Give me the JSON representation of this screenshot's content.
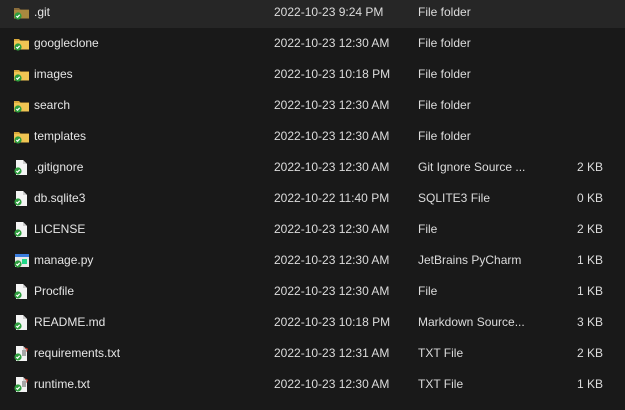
{
  "files": [
    {
      "name": ".git",
      "date": "2022-10-23 9:24 PM",
      "type": "File folder",
      "size": "",
      "icon": "folder-icon"
    },
    {
      "name": "googleclone",
      "date": "2022-10-23 12:30 AM",
      "type": "File folder",
      "size": "",
      "icon": "folder-icon"
    },
    {
      "name": "images",
      "date": "2022-10-23 10:18 PM",
      "type": "File folder",
      "size": "",
      "icon": "folder-icon"
    },
    {
      "name": "search",
      "date": "2022-10-23 12:30 AM",
      "type": "File folder",
      "size": "",
      "icon": "folder-icon"
    },
    {
      "name": "templates",
      "date": "2022-10-23 12:30 AM",
      "type": "File folder",
      "size": "",
      "icon": "folder-icon"
    },
    {
      "name": ".gitignore",
      "date": "2022-10-23 12:30 AM",
      "type": "Git Ignore Source ...",
      "size": "2 KB",
      "icon": "document-icon"
    },
    {
      "name": "db.sqlite3",
      "date": "2022-10-22 11:40 PM",
      "type": "SQLITE3 File",
      "size": "0 KB",
      "icon": "document-icon"
    },
    {
      "name": "LICENSE",
      "date": "2022-10-23 12:30 AM",
      "type": "File",
      "size": "2 KB",
      "icon": "document-icon"
    },
    {
      "name": "manage.py",
      "date": "2022-10-23 12:30 AM",
      "type": "JetBrains PyCharm",
      "size": "1 KB",
      "icon": "pycharm-file-icon"
    },
    {
      "name": "Procfile",
      "date": "2022-10-23 12:30 AM",
      "type": "File",
      "size": "1 KB",
      "icon": "document-icon"
    },
    {
      "name": "README.md",
      "date": "2022-10-23 10:18 PM",
      "type": "Markdown Source...",
      "size": "3 KB",
      "icon": "document-icon"
    },
    {
      "name": "requirements.txt",
      "date": "2022-10-23 12:31 AM",
      "type": "TXT File",
      "size": "2 KB",
      "icon": "text-file-icon"
    },
    {
      "name": "runtime.txt",
      "date": "2022-10-23 12:30 AM",
      "type": "TXT File",
      "size": "1 KB",
      "icon": "text-file-icon"
    }
  ],
  "colors": {
    "background": "#191919",
    "folder": "#e8b94a",
    "sync_badge": "#2e9e3e"
  }
}
